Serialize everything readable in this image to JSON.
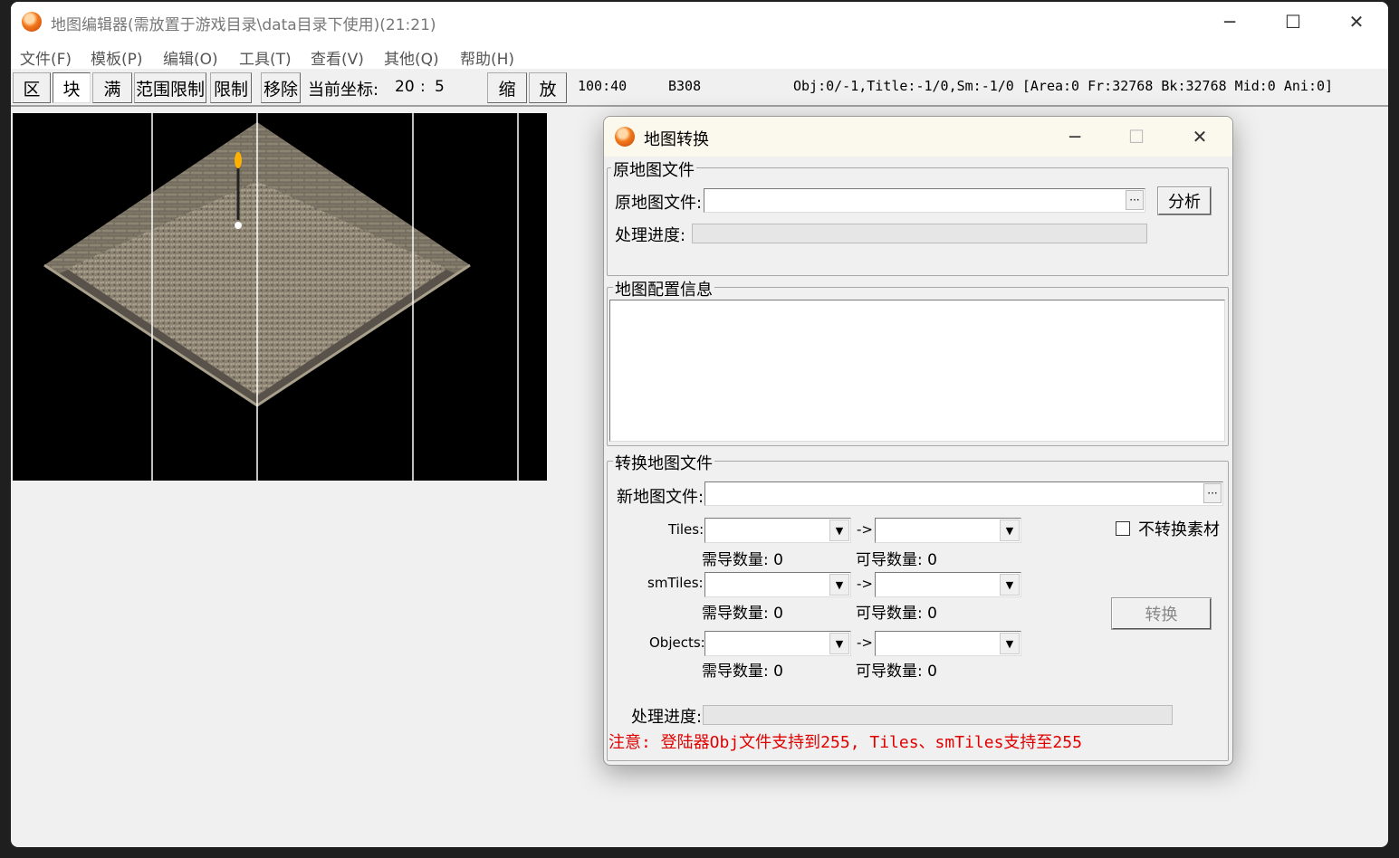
{
  "window": {
    "title": "地图编辑器(需放置于游戏目录\\data目录下使用)(21:21)",
    "minimize": "─",
    "maximize": "☐",
    "close": "✕"
  },
  "menu": [
    "文件(F)",
    "模板(P)",
    "编辑(O)",
    "工具(T)",
    "查看(V)",
    "其他(Q)",
    "帮助(H)"
  ],
  "toolbar": {
    "btn_zone": "区",
    "btn_block": "块",
    "btn_full": "满",
    "btn_range_limit": "范围限制",
    "btn_limit": "限制",
    "btn_remove": "移除",
    "coord_label": "当前坐标:",
    "coord_x": "20",
    "coord_sep": ":",
    "coord_y": "5",
    "btn_shrink": "缩",
    "btn_zoom": "放",
    "zoom_value": "100:40",
    "tile_code": "B308",
    "status": "Obj:0/-1,Title:-1/0,Sm:-1/0 [Area:0 Fr:32768 Bk:32768 Mid:0 Ani:0]"
  },
  "dialog": {
    "title": "地图转换",
    "minimize": "─",
    "maximize": "☐",
    "close": "✕",
    "source_group": "原地图文件",
    "source_file_label": "原地图文件:",
    "source_file_value": "",
    "browse": "···",
    "analyze_button": "分析",
    "progress_label": "处理进度:",
    "config_group": "地图配置信息",
    "config_text": "",
    "convert_group": "转换地图文件",
    "new_file_label": "新地图文件:",
    "new_file_value": "",
    "arrow": "->",
    "rows": [
      {
        "label": "Tiles:",
        "from": "",
        "to": "",
        "need": "需导数量: 0",
        "can": "可导数量: 0"
      },
      {
        "label": "smTiles:",
        "from": "",
        "to": "",
        "need": "需导数量: 0",
        "can": "可导数量: 0"
      },
      {
        "label": "Objects:",
        "from": "",
        "to": "",
        "need": "需导数量: 0",
        "can": "可导数量: 0"
      }
    ],
    "no_convert_label": "不转换素材",
    "no_convert_checked": false,
    "convert_button": "转换",
    "progress_label2": "处理进度:",
    "note": "注意: 登陆器Obj文件支持到255, Tiles、smTiles支持至255",
    "note_color": "#e00000"
  },
  "icons": {
    "app": "app-orange-icon",
    "dropdown": "chevron-down-icon"
  }
}
